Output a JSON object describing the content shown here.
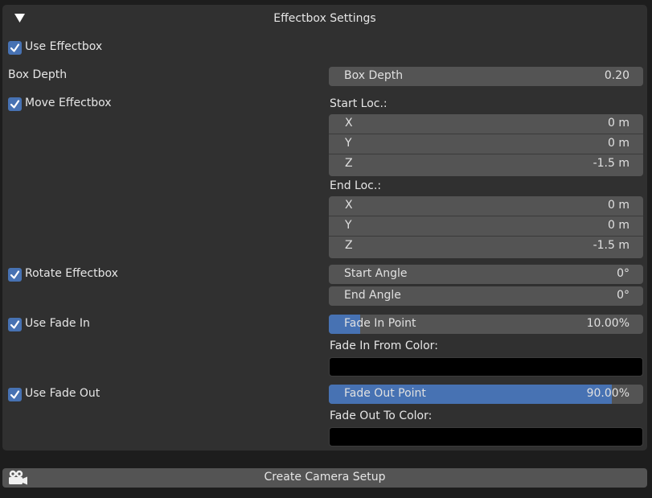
{
  "panel": {
    "title": "Effectbox Settings",
    "use_effectbox": {
      "label": "Use Effectbox",
      "checked": true
    },
    "box_depth": {
      "row_label": "Box Depth",
      "field_label": "Box Depth",
      "value": "0.20"
    },
    "move_effectbox": {
      "label": "Move Effectbox",
      "checked": true,
      "start_label": "Start Loc.:",
      "start": [
        {
          "axis": "X",
          "value": "0 m"
        },
        {
          "axis": "Y",
          "value": "0 m"
        },
        {
          "axis": "Z",
          "value": "-1.5 m"
        }
      ],
      "end_label": "End Loc.:",
      "end": [
        {
          "axis": "X",
          "value": "0 m"
        },
        {
          "axis": "Y",
          "value": "0 m"
        },
        {
          "axis": "Z",
          "value": "-1.5 m"
        }
      ]
    },
    "rotate_effectbox": {
      "label": "Rotate Effectbox",
      "checked": true,
      "start_angle": {
        "label": "Start Angle",
        "value": "0°"
      },
      "end_angle": {
        "label": "End Angle",
        "value": "0°"
      }
    },
    "fade_in": {
      "label": "Use Fade In",
      "checked": true,
      "point_label": "Fade In Point",
      "point_value": "10.00%",
      "point_fraction": 0.1,
      "color_label": "Fade In From Color:",
      "color": "#000000"
    },
    "fade_out": {
      "label": "Use Fade Out",
      "checked": true,
      "point_label": "Fade Out Point",
      "point_value": "90.00%",
      "point_fraction": 0.9,
      "color_label": "Fade Out To Color:",
      "color": "#000000"
    }
  },
  "camera_button": {
    "label": "Create Camera Setup",
    "icon": "camera-icon"
  },
  "colors": {
    "accent": "#4772b3",
    "panel": "#303030",
    "field": "#545454",
    "background": "#1d1d1d"
  }
}
